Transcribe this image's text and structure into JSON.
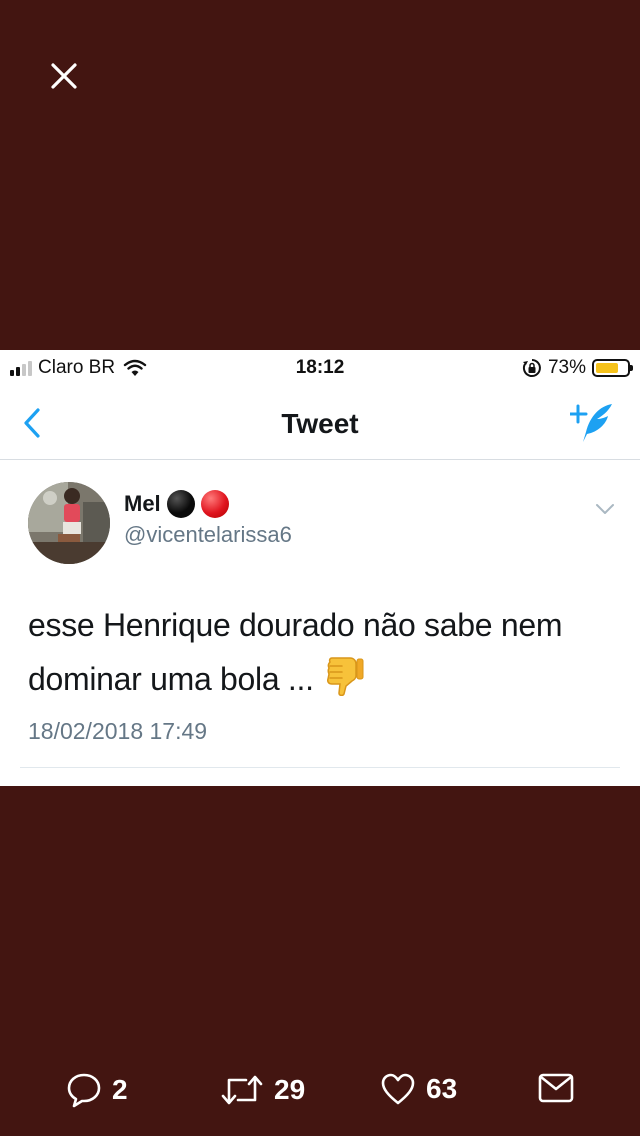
{
  "viewer": {
    "background": "#431511",
    "close_icon": "close-icon"
  },
  "status_bar": {
    "carrier": "Claro BR",
    "time": "18:12",
    "battery_percent": "73%",
    "battery_level": 0.73,
    "icons": [
      "signal-icon",
      "wifi-icon",
      "rotation-lock-icon",
      "battery-icon"
    ]
  },
  "nav": {
    "title": "Tweet",
    "back_icon": "chevron-left-icon",
    "compose_icon": "compose-tweet-icon",
    "accent": "#1da1f2"
  },
  "tweet": {
    "display_name": "Mel",
    "handle": "@vicentelarissa6",
    "text_line1": "esse Henrique dourado não sabe nem",
    "text_line2": "dominar uma bola ...",
    "emoji": "thumbs-down-icon",
    "timestamp": "18/02/2018 17:49",
    "menu_icon": "chevron-down-icon"
  },
  "actions": {
    "replies": "2",
    "retweets": "29",
    "likes": "63",
    "icons": [
      "reply-icon",
      "retweet-icon",
      "heart-icon",
      "message-icon"
    ]
  }
}
